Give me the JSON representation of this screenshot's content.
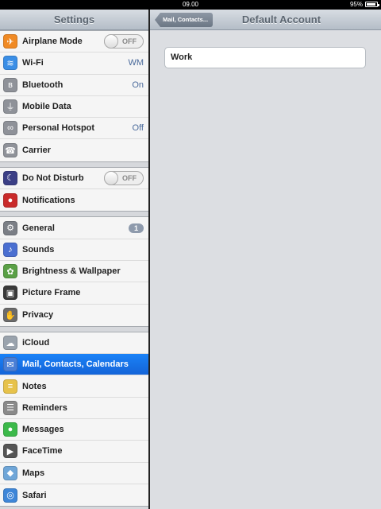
{
  "status_bar": {
    "time": "09.00",
    "battery": "95%"
  },
  "left": {
    "title": "Settings",
    "groups": [
      [
        {
          "label": "Airplane Mode",
          "toggle": "OFF",
          "icon": "airplane-icon",
          "color": "#f08a24"
        },
        {
          "label": "Wi-Fi",
          "value": "WM",
          "icon": "wifi-icon",
          "color": "#3a8ee6"
        },
        {
          "label": "Bluetooth",
          "value": "On",
          "icon": "bluetooth-icon",
          "color": "#8f9299"
        },
        {
          "label": "Mobile Data",
          "icon": "antenna-icon",
          "color": "#8f9299"
        },
        {
          "label": "Personal Hotspot",
          "value": "Off",
          "icon": "hotspot-icon",
          "color": "#8f9299"
        },
        {
          "label": "Carrier",
          "icon": "phone-icon",
          "color": "#8f9299"
        }
      ],
      [
        {
          "label": "Do Not Disturb",
          "toggle": "OFF",
          "icon": "moon-icon",
          "color": "#3b3f86"
        },
        {
          "label": "Notifications",
          "icon": "notifications-icon",
          "color": "#c92a2a"
        }
      ],
      [
        {
          "label": "General",
          "badge": "1",
          "icon": "gear-icon",
          "color": "#7b7f86"
        },
        {
          "label": "Sounds",
          "icon": "speaker-icon",
          "color": "#4a6fd1"
        },
        {
          "label": "Brightness & Wallpaper",
          "icon": "flower-icon",
          "color": "#5aa046"
        },
        {
          "label": "Picture Frame",
          "icon": "picture-frame-icon",
          "color": "#3a3a3a"
        },
        {
          "label": "Privacy",
          "icon": "hand-icon",
          "color": "#6b6b6b"
        }
      ],
      [
        {
          "label": "iCloud",
          "icon": "cloud-icon",
          "color": "#9aa3ad"
        },
        {
          "label": "Mail, Contacts, Calendars",
          "icon": "mail-icon",
          "color": "#4a7fd6",
          "selected": true
        },
        {
          "label": "Notes",
          "icon": "notes-icon",
          "color": "#e7c24a"
        },
        {
          "label": "Reminders",
          "icon": "reminders-icon",
          "color": "#8a8a8a"
        },
        {
          "label": "Messages",
          "icon": "messages-icon",
          "color": "#3cb94a"
        },
        {
          "label": "FaceTime",
          "icon": "facetime-icon",
          "color": "#555"
        },
        {
          "label": "Maps",
          "icon": "maps-icon",
          "color": "#6fa6d8"
        },
        {
          "label": "Safari",
          "icon": "safari-icon",
          "color": "#3e86d8"
        }
      ]
    ]
  },
  "right": {
    "back_label": "Mail, Contacts...",
    "title": "Default Account",
    "account": "Work"
  }
}
